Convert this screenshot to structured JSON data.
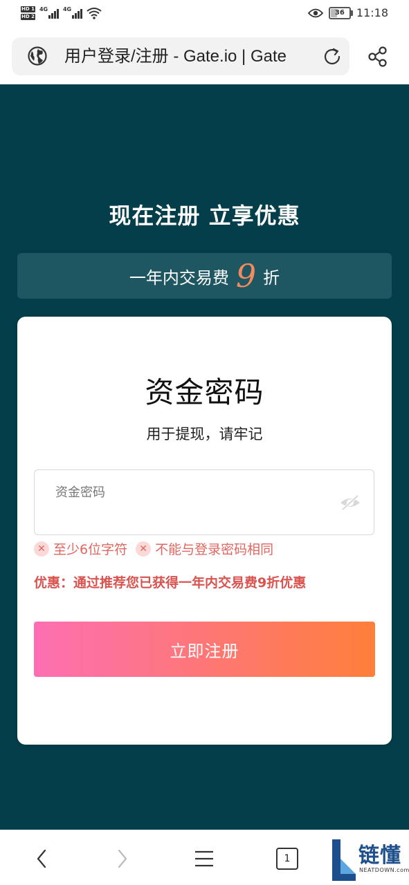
{
  "status_bar": {
    "sim1": "HD 1",
    "sim2": "HD 2",
    "net1": "4G",
    "net2": "4G",
    "battery": "36",
    "time": "11:18"
  },
  "browser": {
    "url_title": "用户登录/注册 - Gate.io | Gate",
    "icons": [
      "globe-icon",
      "reload-icon",
      "share-icon"
    ]
  },
  "page": {
    "headline": "现在注册 立享优惠",
    "promo": {
      "prefix": "一年内交易费",
      "number": "9",
      "suffix": "折",
      "number_color": "#f08b5e"
    },
    "card": {
      "title": "资金密码",
      "subtitle": "用于提现，请牢记",
      "password_label": "资金密码",
      "rules": [
        "至少6位字符",
        "不能与登录密码相同"
      ],
      "promo_note": "优惠：通过推荐您已获得一年内交易费9折优惠",
      "register_label": "立即注册"
    },
    "colors": {
      "background": "#033e4a",
      "promo_strip": "#1e5661",
      "error": "#e0665f",
      "button_gradient_start": "#fd6fb3",
      "button_gradient_end": "#fe7f3a"
    }
  },
  "bottom_nav": {
    "tab_count": "1",
    "watermark_text": "链懂",
    "watermark_sub": "NEATDOWN.com"
  }
}
